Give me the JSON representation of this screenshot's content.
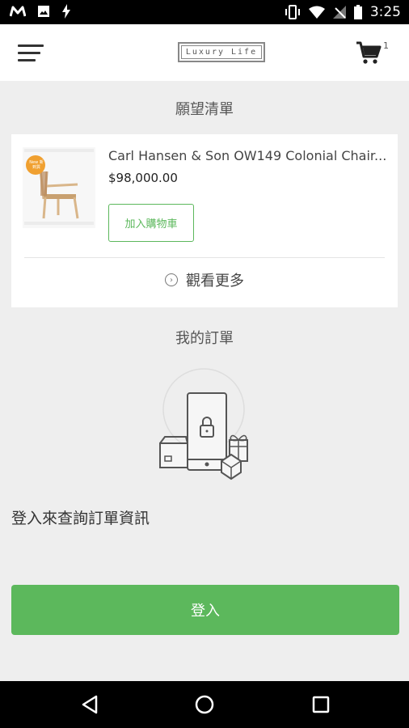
{
  "status_bar": {
    "time": "3:25",
    "left_icons": [
      "m-app-icon",
      "image-icon",
      "flash-icon"
    ],
    "right_icons": [
      "vibrate-icon",
      "wifi-icon",
      "no-signal-icon",
      "battery-icon"
    ]
  },
  "header": {
    "logo_text": "Luxury Life",
    "cart_count": "1"
  },
  "wishlist": {
    "title": "願望清單",
    "product": {
      "name": "Carl Hansen & Son OW149 Colonial Chair...",
      "price": "$98,000.00",
      "badge": "New 新到貨",
      "add_to_cart_label": "加入購物車"
    },
    "view_more_label": "觀看更多"
  },
  "orders": {
    "title": "我的訂單",
    "login_hint": "登入來查詢訂單資訊",
    "login_button": "登入"
  },
  "colors": {
    "accent_green": "#5cb85c",
    "background": "#eeeeee"
  }
}
